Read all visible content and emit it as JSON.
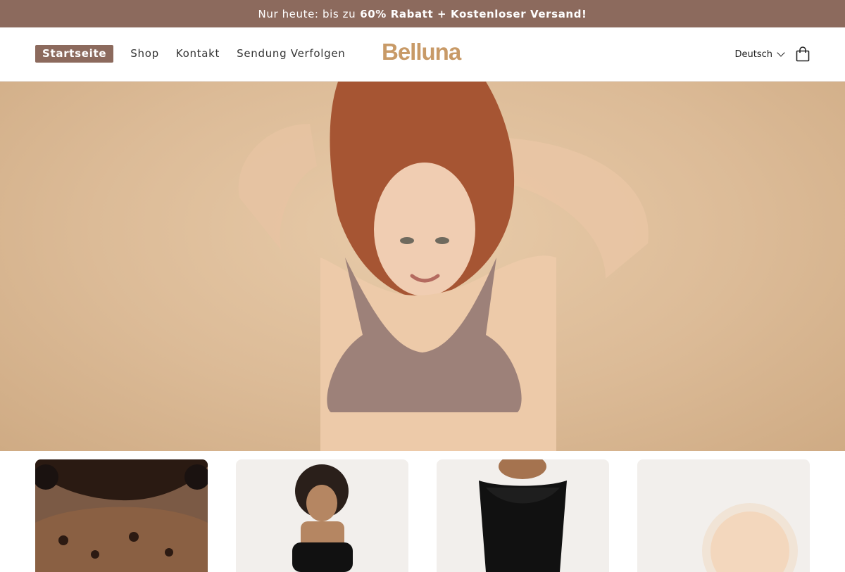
{
  "announcement": {
    "prefix": "Nur heute: bis zu",
    "highlight": "60% Rabatt + Kostenloser Versand!"
  },
  "nav": {
    "items": [
      {
        "label": "Startseite"
      },
      {
        "label": "Shop"
      },
      {
        "label": "Kontakt"
      },
      {
        "label": "Sendung Verfolgen"
      }
    ]
  },
  "brand": {
    "name": "Belluna",
    "color": "#c89a67"
  },
  "language": {
    "selected": "Deutsch"
  },
  "icons": {
    "cart": "shopping-bag-icon",
    "language_toggle": "chevron-down-icon"
  },
  "colors": {
    "accent": "#8c6a5d",
    "hero_bg": "#dcbb97"
  },
  "cards": [
    {
      "image": "leopard-print-bra"
    },
    {
      "image": "black-bra-model"
    },
    {
      "image": "black-shapewear-bodysuit"
    },
    {
      "image": "nude-nipple-cover"
    }
  ]
}
